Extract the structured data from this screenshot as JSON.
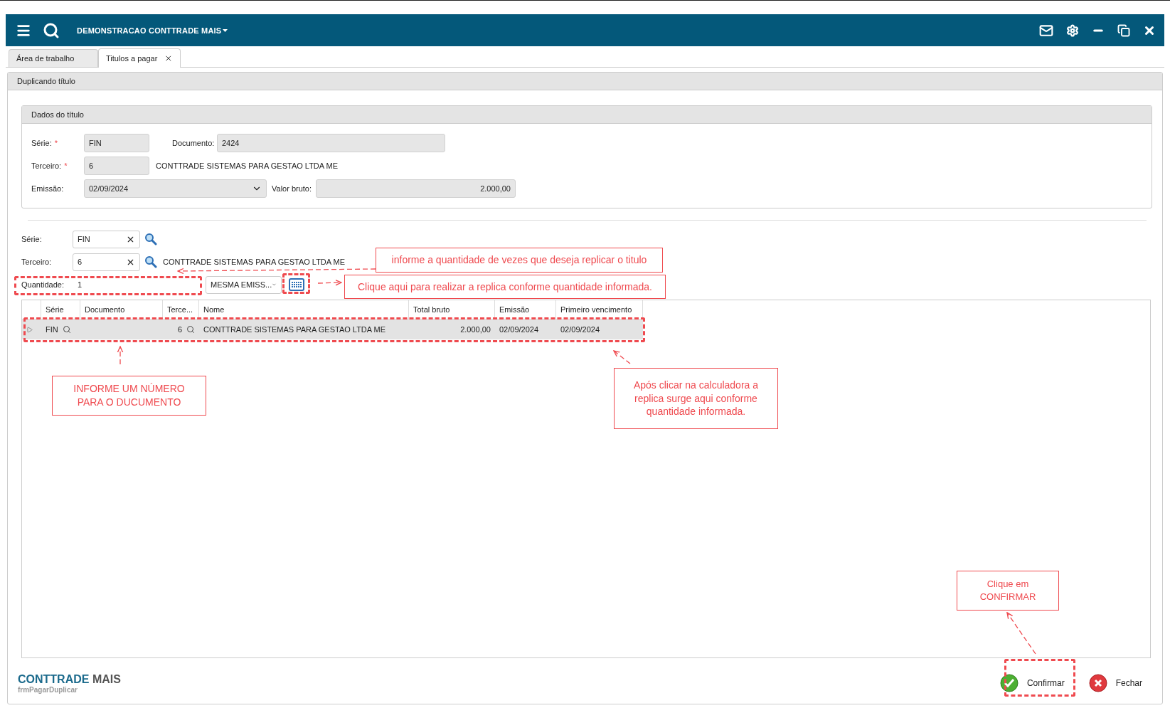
{
  "window": {
    "title": "DEMONSTRACAO CONTTRADE MAIS"
  },
  "tabs": [
    {
      "label": "Área de trabalho",
      "selected": false,
      "closable": false
    },
    {
      "label": "Titulos a pagar",
      "selected": true,
      "closable": true
    }
  ],
  "panel": {
    "title": "Duplicando título"
  },
  "title_data": {
    "title": "Dados do título",
    "serie": {
      "label": "Série:",
      "marker": "*",
      "value": "FIN"
    },
    "documento": {
      "label": "Documento:",
      "value": "2424"
    },
    "terceiro": {
      "label": "Terceiro:",
      "marker": "*",
      "value": "6",
      "name": "CONTTRADE SISTEMAS PARA GESTAO LTDA ME"
    },
    "emissao": {
      "label": "Emissão:",
      "value": "02/09/2024"
    },
    "valor_bruto": {
      "label": "Valor bruto:",
      "value": "2.000,00"
    }
  },
  "replicate": {
    "serie": {
      "label": "Série:",
      "value": "FIN"
    },
    "terceiro": {
      "label": "Terceiro:",
      "value": "6",
      "name": "CONTTRADE SISTEMAS PARA GESTAO LTDA ME"
    },
    "quantidade": {
      "label": "Quantidade:",
      "value": "1"
    },
    "mode": {
      "value": "MESMA EMISS..."
    }
  },
  "grid": {
    "columns": [
      {
        "label": "Série",
        "lookup": true
      },
      {
        "label": "Documento",
        "lookup": false
      },
      {
        "label": "Terce...",
        "lookup": true
      },
      {
        "label": "Nome",
        "lookup": false
      },
      {
        "label": "Total bruto",
        "lookup": false
      },
      {
        "label": "Emissão",
        "lookup": false
      },
      {
        "label": "Primeiro vencimento",
        "lookup": false
      }
    ],
    "rows": [
      {
        "selected": true,
        "serie": "FIN",
        "terceiro": "6",
        "nome": "CONTTRADE SISTEMAS PARA GESTAO LTDA ME",
        "total_bruto": "2.000,00",
        "emissao": "02/09/2024",
        "primeiro_vencimento": "02/09/2024"
      }
    ]
  },
  "footer": {
    "brand": {
      "first": "CONTTRADE",
      "second": "MAIS"
    },
    "form_name": "frmPagarDuplicar",
    "buttons": [
      {
        "label": "Confirmar",
        "kind": "confirm"
      },
      {
        "label": "Fechar",
        "kind": "close"
      }
    ]
  },
  "annotations": [
    {
      "text": "informe a quantidade de vezes que deseja replicar o titulo"
    },
    {
      "text": "Clique aqui para realizar a replica conforme quantidade informada."
    },
    {
      "text": "INFORME UM NÚMERO PARA O DUCUMENTO"
    },
    {
      "text": "Após clicar na calculadora a replica surge aqui conforme quantidade informada."
    },
    {
      "text": "Clique em CONFIRMAR"
    }
  ]
}
